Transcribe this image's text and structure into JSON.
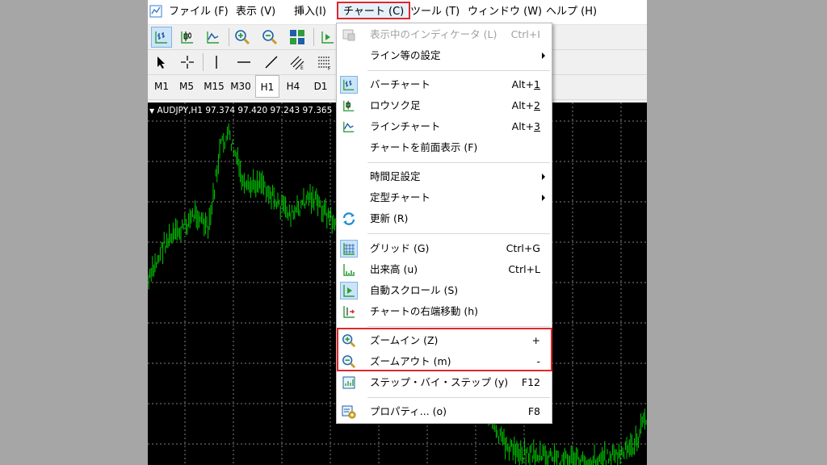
{
  "menubar": {
    "items": [
      {
        "label": "ファイル (F)"
      },
      {
        "label": "表示 (V)"
      },
      {
        "label": "挿入(I)"
      },
      {
        "label": "チャート (C)"
      },
      {
        "label": "ツール (T)"
      },
      {
        "label": "ウィンドウ (W)"
      },
      {
        "label": "ヘルプ (H)"
      }
    ]
  },
  "timeframes": [
    "M1",
    "M5",
    "M15",
    "M30",
    "H1",
    "H4",
    "D1"
  ],
  "active_timeframe": "H1",
  "chart": {
    "label": "AUDJPY,H1  97.374 97.420 97.243 97.365",
    "candle_color": "#00c800",
    "background": "#000000",
    "grid_color": "#7f7f7f"
  },
  "menu": {
    "show_indicators": {
      "label": "表示中のインディケータ (L)",
      "shortcut": "Ctrl+I"
    },
    "line_settings": {
      "label": "ライン等の設定"
    },
    "bar_chart": {
      "label": "バーチャート",
      "shortcut_prefix": "Alt+",
      "shortcut_key": "1"
    },
    "candlestick": {
      "label": "ロウソク足",
      "shortcut_prefix": "Alt+",
      "shortcut_key": "2"
    },
    "line_chart": {
      "label": "ラインチャート",
      "shortcut_prefix": "Alt+",
      "shortcut_key": "3"
    },
    "foreground": {
      "label": "チャートを前面表示 (F)"
    },
    "timeframe": {
      "label": "時間足設定"
    },
    "template": {
      "label": "定型チャート"
    },
    "refresh": {
      "label": "更新 (R)"
    },
    "grid": {
      "label": "グリッド (G)",
      "shortcut": "Ctrl+G"
    },
    "volume": {
      "label": "出来高 (u)",
      "shortcut": "Ctrl+L"
    },
    "autoscroll": {
      "label": "自動スクロール (S)"
    },
    "chart_shift": {
      "label": "チャートの右端移動 (h)"
    },
    "zoom_in": {
      "label": "ズームイン (Z)",
      "shortcut": "+"
    },
    "zoom_out": {
      "label": "ズームアウト (m)",
      "shortcut": "-"
    },
    "step_by_step": {
      "label": "ステップ・バイ・ステップ (y)",
      "shortcut": "F12"
    },
    "properties": {
      "label": "プロパティ... (o)",
      "shortcut": "F8"
    }
  },
  "colors": {
    "highlight_border": "#e2262b",
    "checked_bg": "#cce4f7",
    "icon_blue": "#1f5fa8",
    "icon_green": "#2e9e3a"
  }
}
